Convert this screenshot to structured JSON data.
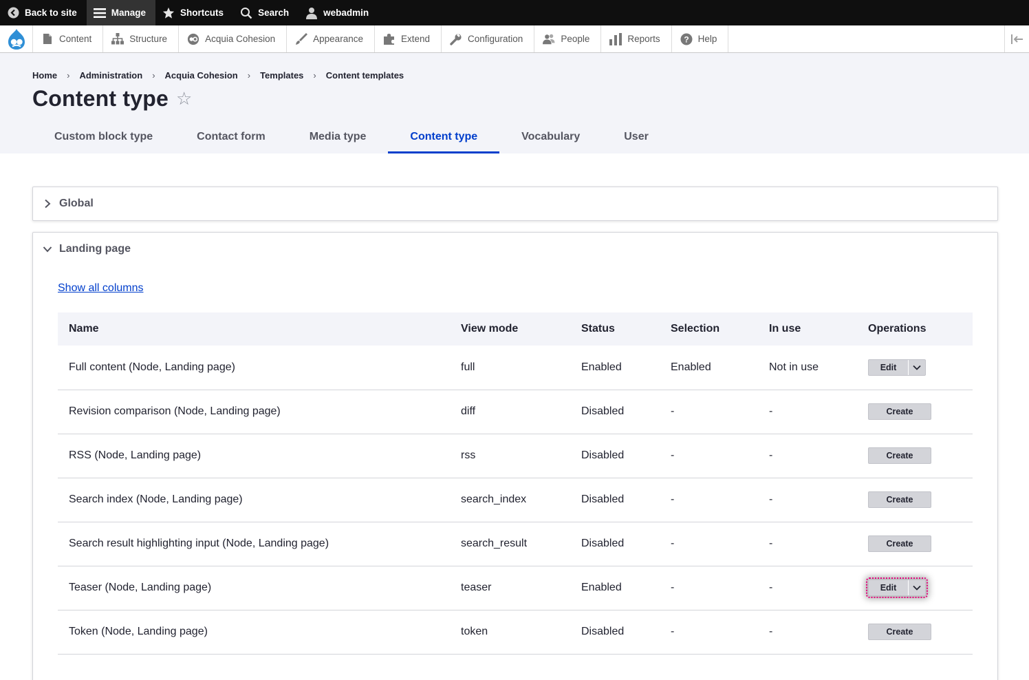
{
  "toolbar": {
    "back_to_site": "Back to site",
    "manage": "Manage",
    "shortcuts": "Shortcuts",
    "search": "Search",
    "user": "webadmin"
  },
  "tray": {
    "items": [
      {
        "label": "Content",
        "icon": "file-icon"
      },
      {
        "label": "Structure",
        "icon": "structure-icon"
      },
      {
        "label": "Acquia Cohesion",
        "icon": "cohesion-icon"
      },
      {
        "label": "Appearance",
        "icon": "brush-icon"
      },
      {
        "label": "Extend",
        "icon": "puzzle-icon"
      },
      {
        "label": "Configuration",
        "icon": "wrench-icon"
      },
      {
        "label": "People",
        "icon": "people-icon"
      },
      {
        "label": "Reports",
        "icon": "bar-chart-icon"
      },
      {
        "label": "Help",
        "icon": "help-icon"
      }
    ]
  },
  "breadcrumb": [
    "Home",
    "Administration",
    "Acquia Cohesion",
    "Templates",
    "Content templates"
  ],
  "page": {
    "title": "Content type"
  },
  "tabs": [
    {
      "label": "Custom block type",
      "active": false
    },
    {
      "label": "Contact form",
      "active": false
    },
    {
      "label": "Media type",
      "active": false
    },
    {
      "label": "Content type",
      "active": true
    },
    {
      "label": "Vocabulary",
      "active": false
    },
    {
      "label": "User",
      "active": false
    }
  ],
  "global_panel": {
    "title": "Global",
    "expanded": false
  },
  "landing_panel": {
    "title": "Landing page",
    "expanded": true,
    "show_all_columns": "Show all columns",
    "columns": [
      "Name",
      "View mode",
      "Status",
      "Selection",
      "In use",
      "Operations"
    ],
    "rows": [
      {
        "name": "Full content (Node, Landing page)",
        "view_mode": "full",
        "status": "Enabled",
        "selection": "Enabled",
        "in_use": "Not in use",
        "operation": "Edit",
        "has_dropdown": true,
        "focused": false
      },
      {
        "name": "Revision comparison (Node, Landing page)",
        "view_mode": "diff",
        "status": "Disabled",
        "selection": "-",
        "in_use": "-",
        "operation": "Create",
        "has_dropdown": false,
        "focused": false
      },
      {
        "name": "RSS (Node, Landing page)",
        "view_mode": "rss",
        "status": "Disabled",
        "selection": "-",
        "in_use": "-",
        "operation": "Create",
        "has_dropdown": false,
        "focused": false
      },
      {
        "name": "Search index (Node, Landing page)",
        "view_mode": "search_index",
        "status": "Disabled",
        "selection": "-",
        "in_use": "-",
        "operation": "Create",
        "has_dropdown": false,
        "focused": false
      },
      {
        "name": "Search result highlighting input (Node, Landing page)",
        "view_mode": "search_result",
        "status": "Disabled",
        "selection": "-",
        "in_use": "-",
        "operation": "Create",
        "has_dropdown": false,
        "focused": false
      },
      {
        "name": "Teaser (Node, Landing page)",
        "view_mode": "teaser",
        "status": "Enabled",
        "selection": "-",
        "in_use": "-",
        "operation": "Edit",
        "has_dropdown": true,
        "focused": true
      },
      {
        "name": "Token (Node, Landing page)",
        "view_mode": "token",
        "status": "Disabled",
        "selection": "-",
        "in_use": "-",
        "operation": "Create",
        "has_dropdown": false,
        "focused": false
      }
    ]
  },
  "colors": {
    "toolbar_bg": "#0f0f0f",
    "accent_blue": "#003ecc",
    "header_bg": "#f3f4f9",
    "focus_outline": "#e6007e"
  }
}
